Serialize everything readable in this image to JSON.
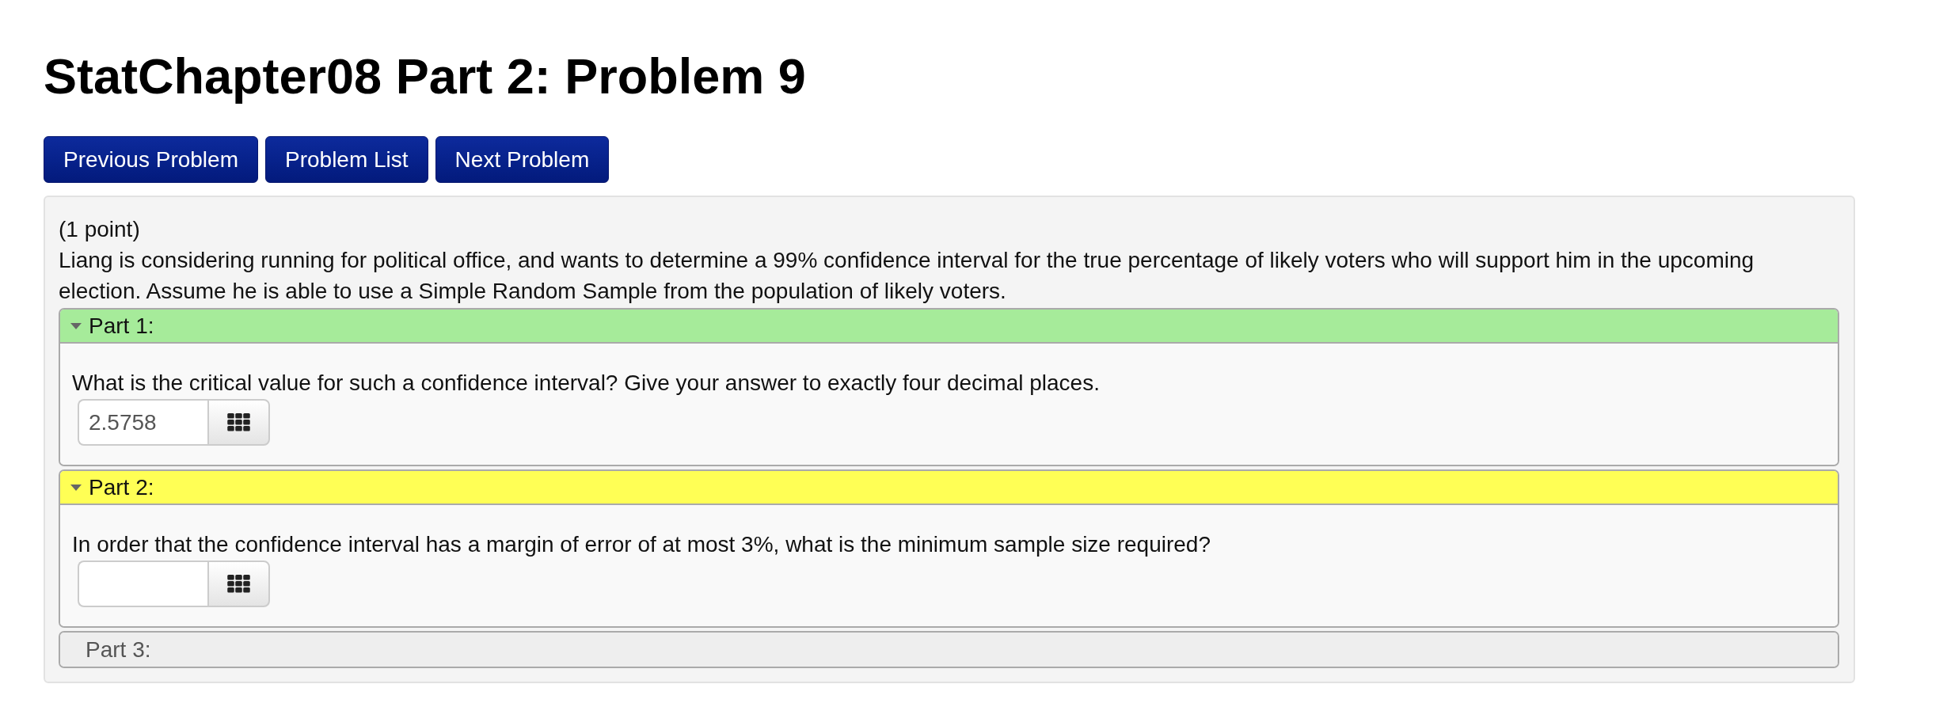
{
  "title": "StatChapter08 Part 2: Problem 9",
  "nav_buttons": [
    "Previous Problem",
    "Problem List",
    "Next Problem"
  ],
  "problem": {
    "points": "(1 point)",
    "statement": "Liang is considering running for political office, and wants to determine a 99% confidence interval for the true percentage of likely voters who will support him in the upcoming election. Assume he is able to use a Simple Random Sample from the population of likely voters.",
    "parts": [
      {
        "label": "Part 1:",
        "expanded": true,
        "color": "#a6eb9a",
        "question": "What is the critical value for such a confidence interval? Give your answer to exactly four decimal places.",
        "answer_field": true,
        "answer": "2.5758"
      },
      {
        "label": "Part 2:",
        "expanded": true,
        "color": "#ffff55",
        "question": "In order that the confidence interval has a margin of error of at most 3%, what is the minimum sample size required?",
        "answer_field": true
      },
      {
        "label": "Part 3:",
        "expanded": false,
        "color": "#eeeeee"
      }
    ]
  }
}
